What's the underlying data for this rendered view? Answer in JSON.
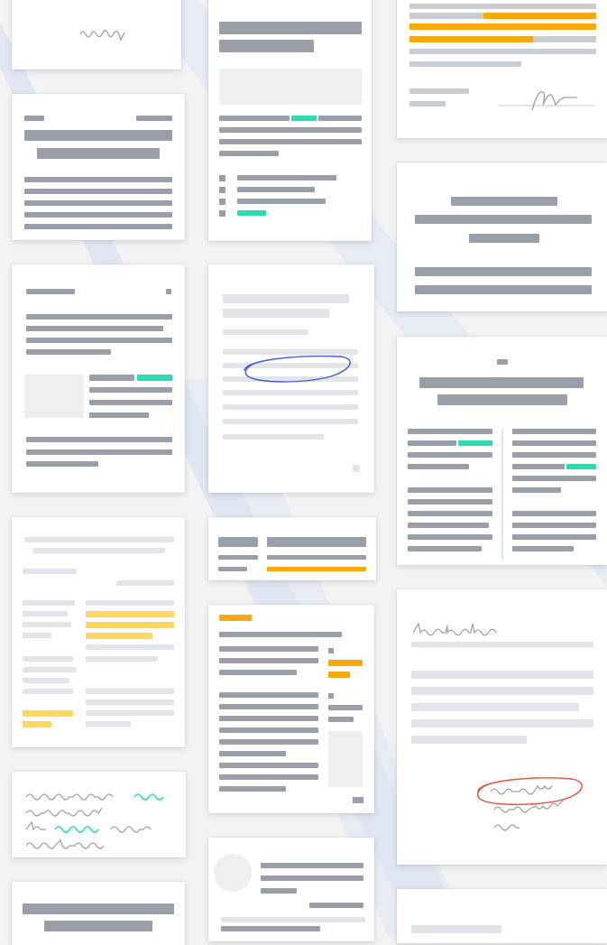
{
  "colors": {
    "background": "#f3f3f5",
    "band": "#dde3f1",
    "bar": "#9a9ea6",
    "bar_light": "#e3e4e7",
    "accent_teal": "#2ddbb0",
    "accent_orange": "#f8a90e",
    "accent_yellow": "#fcd75a",
    "ink_blue": "#3f5fe0",
    "ink_red": "#e0503a"
  },
  "cards": [
    "signature-card-top-left",
    "letter-card-left",
    "report-card-center-top",
    "highlight-card-right-top",
    "summary-card-right",
    "form-card-left",
    "annotated-card-center",
    "two-column-card-right",
    "ledger-card-left",
    "table-strip-card-center",
    "invoice-card-center",
    "signed-letter-card-right",
    "handwritten-note-card-left",
    "profile-card-center-bottom",
    "title-card-left-bottom",
    "partial-card-right-bottom"
  ],
  "icons": [
    "scribble-icon",
    "signature-icon",
    "circle-annotation-icon",
    "handwriting-icon",
    "avatar-placeholder"
  ]
}
